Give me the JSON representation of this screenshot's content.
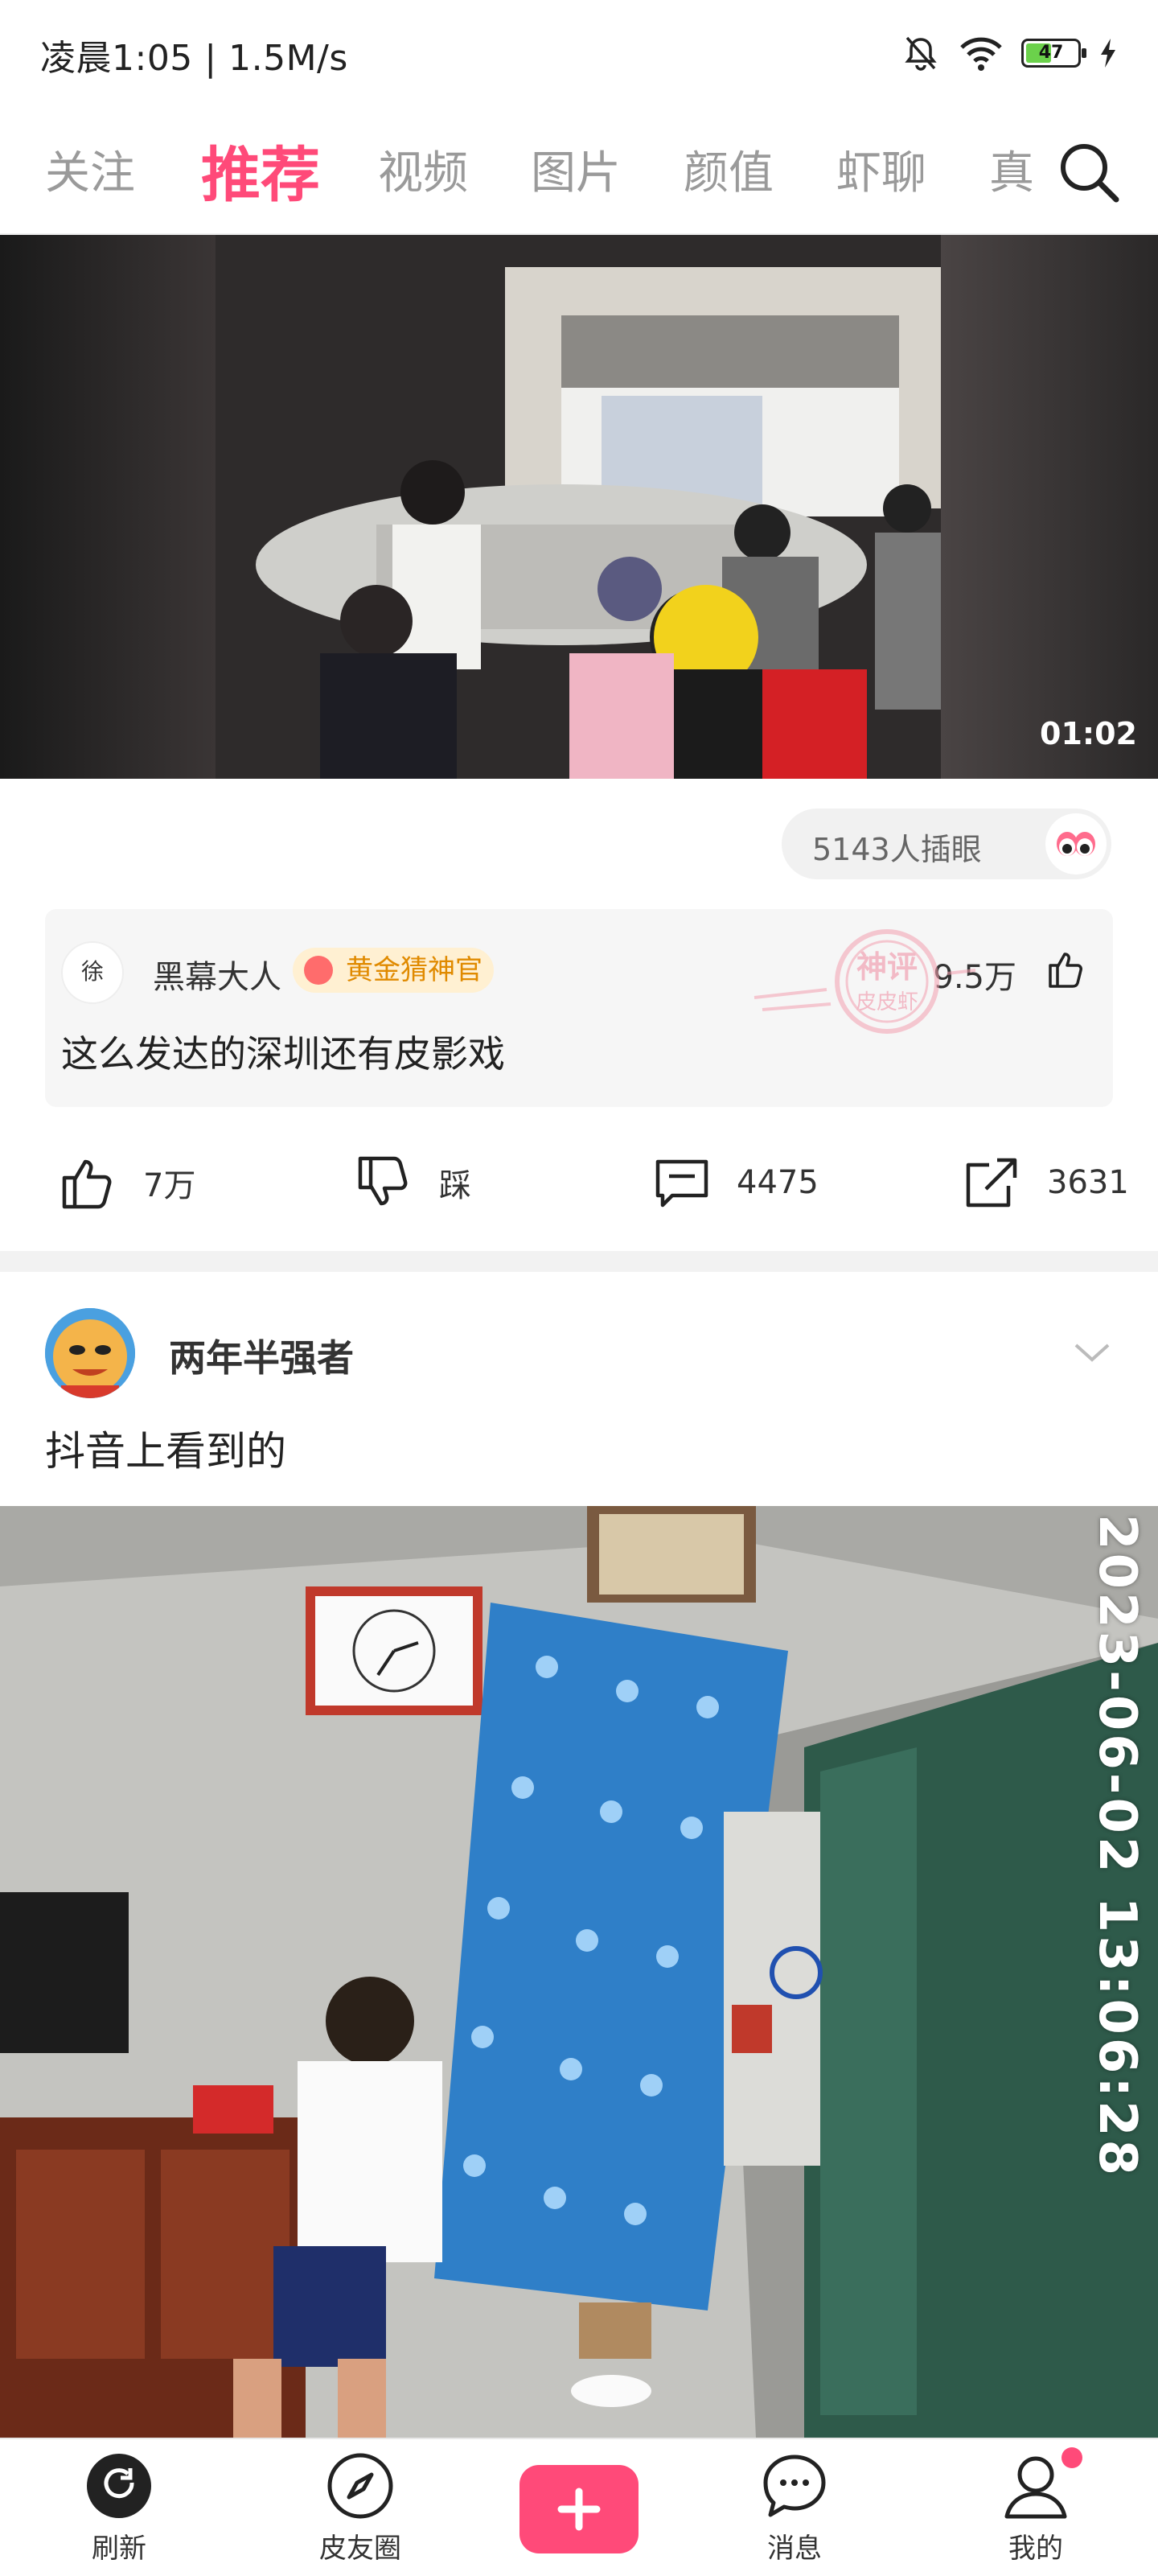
{
  "status_bar": {
    "time_speed": "凌晨1:05 | 1.5M/s",
    "battery": "47"
  },
  "tabs": [
    "关注",
    "推荐",
    "视频",
    "图片",
    "颜值",
    "虾聊",
    "真"
  ],
  "active_tab": "推荐",
  "post1": {
    "duration": "01:02",
    "eye_count": "5143人插眼",
    "god_comment": {
      "user": "黑幕大人",
      "badge": "黄金猜神官",
      "likes": "9.5万",
      "text": "这么发达的深圳还有皮影戏",
      "stamp_title": "神评",
      "stamp_sub": "皮皮虾",
      "avatar_text": "徐"
    },
    "actions": {
      "like": "7万",
      "dislike": "踩",
      "comment": "4475",
      "share": "3631"
    }
  },
  "post2": {
    "user": "两年半强者",
    "text": "抖音上看到的",
    "timestamp": "2023-06-02 13:06:28"
  },
  "bottom_nav": [
    "刷新",
    "皮友圈",
    "",
    "消息",
    "我的"
  ],
  "colors": {
    "accent": "#ff4a79",
    "badge": "#e08a00"
  }
}
